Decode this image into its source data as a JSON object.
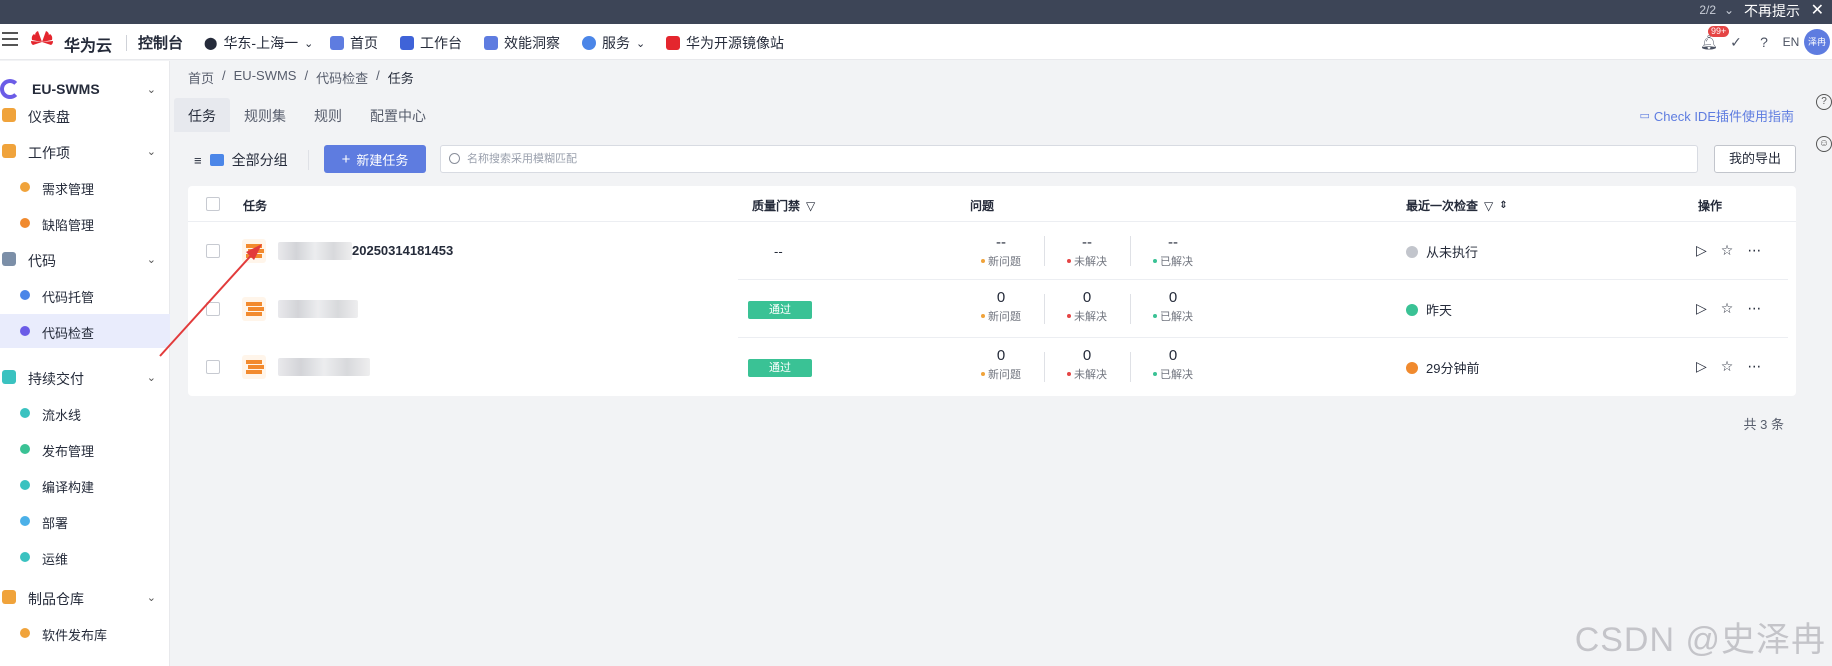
{
  "notice": {
    "pager": "2/2",
    "dismiss": "不再提示",
    "close": "✕"
  },
  "header": {
    "brand": "华为云",
    "console": "控制台",
    "region": "华东-上海一",
    "nav": [
      "首页",
      "工作台",
      "效能洞察",
      "服务",
      "华为开源镜像站"
    ],
    "notification_badge": "99+",
    "lang": "EN",
    "avatar": "泽冉"
  },
  "sidebar": {
    "project": "EU-SWMS",
    "items": [
      {
        "label": "仪表盘",
        "level": 0
      },
      {
        "label": "工作项",
        "level": 0,
        "expandable": true
      },
      {
        "label": "需求管理",
        "level": 1
      },
      {
        "label": "缺陷管理",
        "level": 1
      },
      {
        "label": "代码",
        "level": 0,
        "expandable": true
      },
      {
        "label": "代码托管",
        "level": 1
      },
      {
        "label": "代码检查",
        "level": 1,
        "active": true
      },
      {
        "label": "持续交付",
        "level": 0,
        "expandable": true
      },
      {
        "label": "流水线",
        "level": 1
      },
      {
        "label": "发布管理",
        "level": 1
      },
      {
        "label": "编译构建",
        "level": 1
      },
      {
        "label": "部署",
        "level": 1
      },
      {
        "label": "运维",
        "level": 1
      },
      {
        "label": "制品仓库",
        "level": 0,
        "expandable": true
      },
      {
        "label": "软件发布库",
        "level": 1
      }
    ]
  },
  "breadcrumb": [
    "首页",
    "EU-SWMS",
    "代码检查",
    "任务"
  ],
  "tabs": [
    "任务",
    "规则集",
    "规则",
    "配置中心"
  ],
  "guide_link": "Check IDE插件使用指南",
  "toolbar": {
    "group": "全部分组",
    "new_task": "新建任务",
    "search_placeholder": "名称搜索采用模糊匹配",
    "export": "我的导出"
  },
  "table": {
    "headers": {
      "task": "任务",
      "gate": "质量门禁",
      "issues": "问题",
      "last_check": "最近一次检查",
      "ops": "操作"
    },
    "metric_labels": [
      "新问题",
      "未解决",
      "已解决"
    ],
    "rows": [
      {
        "name_suffix": "20250314181453",
        "gate": "--",
        "metrics": [
          "--",
          "--",
          "--"
        ],
        "last_check": "从未执行",
        "status": "never"
      },
      {
        "name_suffix": "",
        "gate": "通过",
        "metrics": [
          "0",
          "0",
          "0"
        ],
        "last_check": "昨天",
        "status": "success"
      },
      {
        "name_suffix": "",
        "gate": "通过",
        "metrics": [
          "0",
          "0",
          "0"
        ],
        "last_check": "29分钟前",
        "status": "running"
      }
    ]
  },
  "total": "共 3 条",
  "watermark": "CSDN @史泽冉",
  "colors": {
    "primary": "#5e7ce0",
    "pass": "#3ac295",
    "arrow": "#e23b3b",
    "new_dot": "#f0a33b",
    "unresolved_dot": "#e54545",
    "resolved_dot": "#3ac295"
  }
}
